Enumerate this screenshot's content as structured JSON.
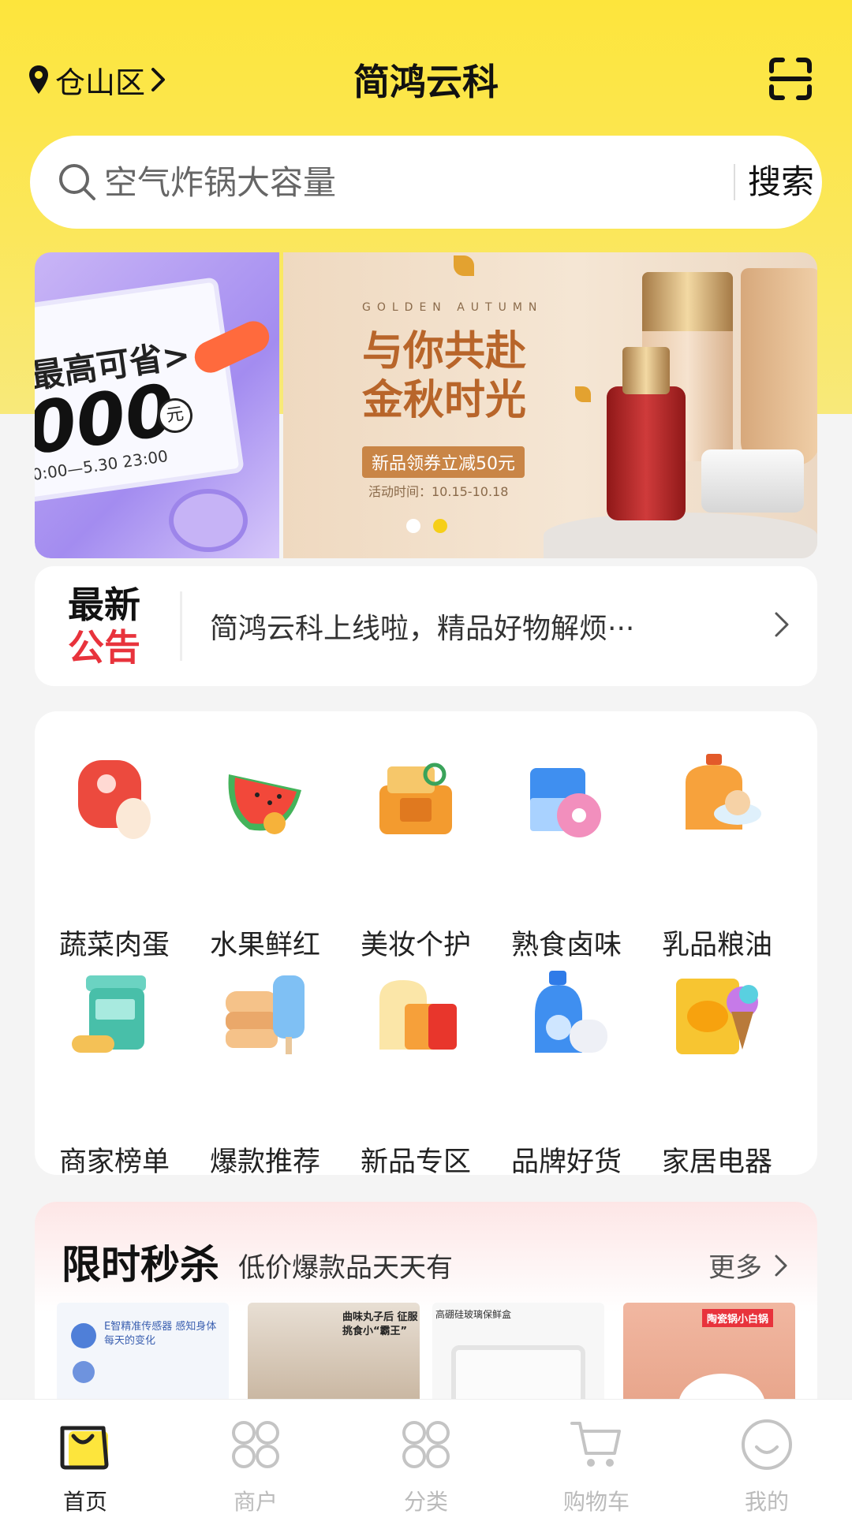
{
  "header": {
    "location": "仓山区",
    "title": "简鸿云科"
  },
  "search": {
    "placeholder": "空气炸锅大容量",
    "button": "搜索"
  },
  "banner": {
    "left": {
      "line1": "最高可省>",
      "line2": "000",
      "unit": "元",
      "date": "0:00—5.30 23:00"
    },
    "right": {
      "eyebrow": "GOLDEN AUTUMN",
      "headline": "与你共赴\n金秋时光",
      "badge": "新品领券立减50元",
      "time": "活动时间：10.15-10.18"
    }
  },
  "notice": {
    "label_top": "最新",
    "label_bottom": "公告",
    "message": "简鸿云科上线啦，精品好物解烦···"
  },
  "categories": [
    {
      "label": "蔬菜肉蛋",
      "icon": "meat-egg-icon"
    },
    {
      "label": "水果鲜红",
      "icon": "watermelon-icon"
    },
    {
      "label": "美妆个护",
      "icon": "cosmetics-basket-icon"
    },
    {
      "label": "熟食卤味",
      "icon": "milk-donut-icon"
    },
    {
      "label": "乳品粮油",
      "icon": "oil-bowl-icon"
    },
    {
      "label": "商家榜单",
      "icon": "jar-capsule-icon"
    },
    {
      "label": "爆款推荐",
      "icon": "bread-icepop-icon"
    },
    {
      "label": "新品专区",
      "icon": "toast-drink-icon"
    },
    {
      "label": "品牌好货",
      "icon": "detergent-roll-icon"
    },
    {
      "label": "家居电器",
      "icon": "chips-icecream-icon"
    }
  ],
  "flash_sale": {
    "title": "限时秒杀",
    "subtitle": "低价爆款品天天有",
    "more": "更多",
    "products": [
      {
        "caption": "E智精准传感器 感知身体每天的变化"
      },
      {
        "caption": "曲味丸子后 征服挑食小“霸王”"
      },
      {
        "caption": "高硼硅玻璃保鲜盒"
      },
      {
        "caption": "陶瓷锅小白锅"
      }
    ]
  },
  "tabbar": [
    {
      "label": "首页",
      "icon": "home-bag-icon",
      "active": true
    },
    {
      "label": "商户",
      "icon": "merchant-grid-icon",
      "active": false
    },
    {
      "label": "分类",
      "icon": "category-grid-icon",
      "active": false
    },
    {
      "label": "购物车",
      "icon": "cart-icon",
      "active": false
    },
    {
      "label": "我的",
      "icon": "smile-face-icon",
      "active": false
    }
  ],
  "colors": {
    "brand_yellow": "#fde53c",
    "notice_red": "#e8333c",
    "active_tab": "#222222",
    "inactive_tab": "#bbbbbb"
  }
}
